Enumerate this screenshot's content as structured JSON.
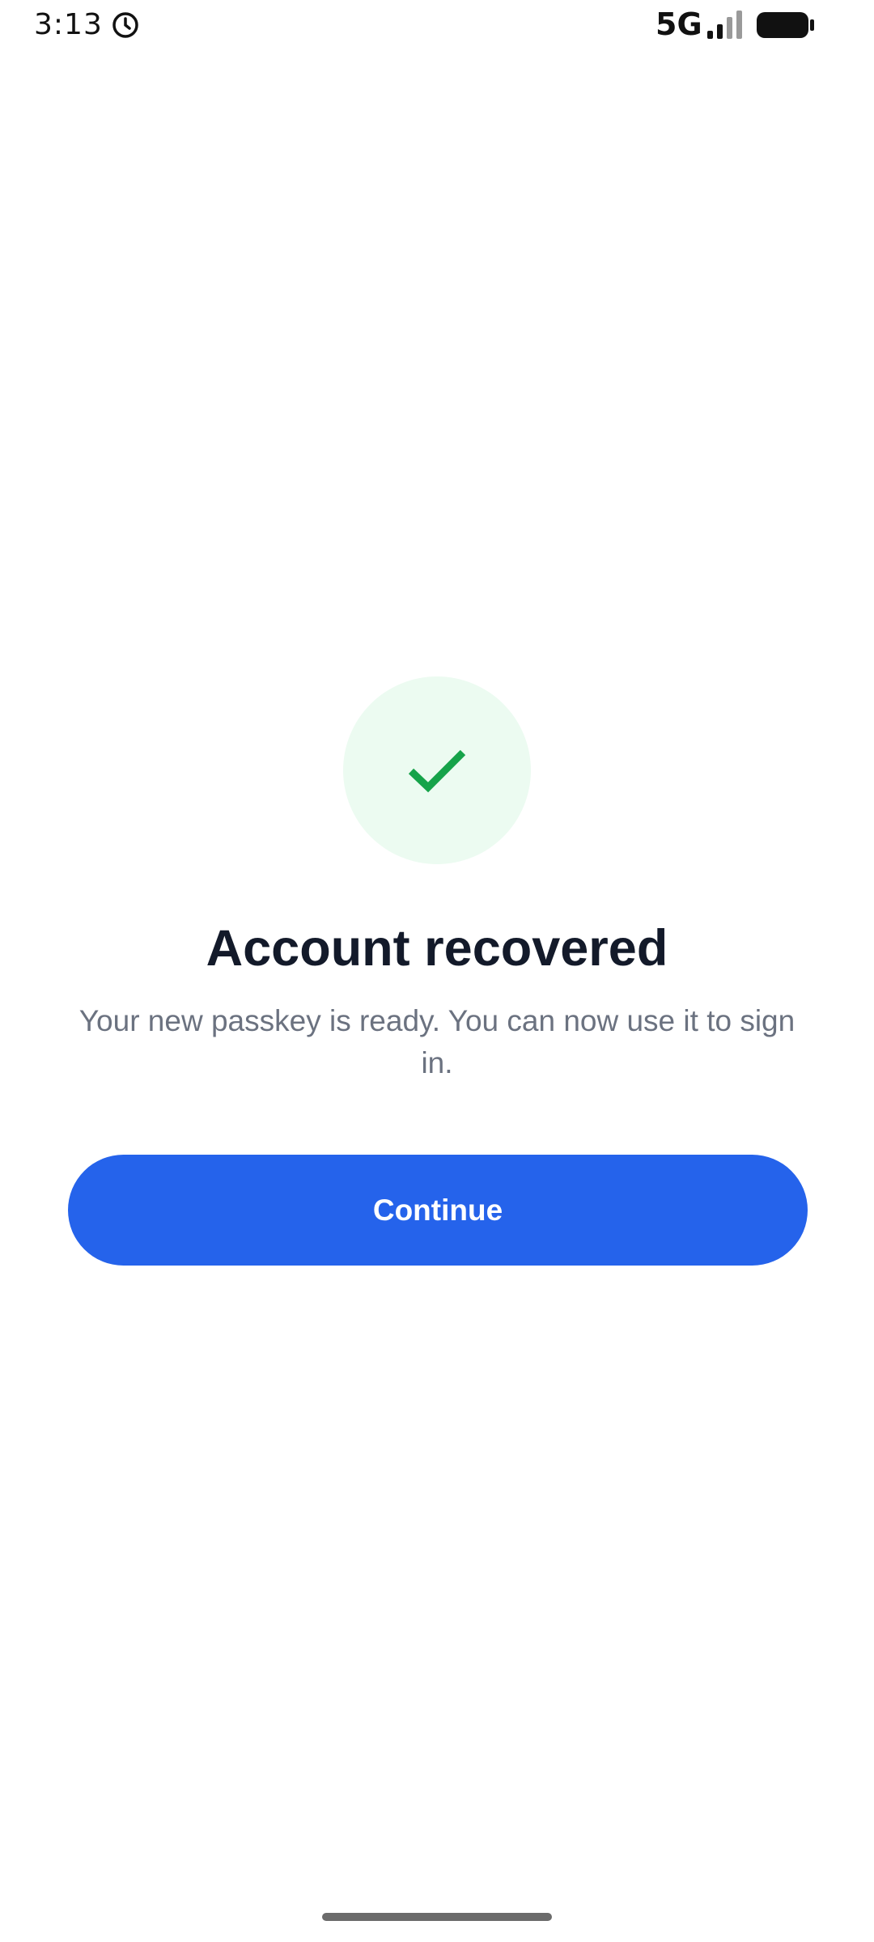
{
  "status_bar": {
    "time": "3:13",
    "network": "5G",
    "icons": [
      "alarm-icon",
      "signal-icon",
      "battery-icon"
    ]
  },
  "success": {
    "icon": "checkmark-icon",
    "badge_color": "#ecfbf1",
    "check_color": "#16a34a"
  },
  "content": {
    "title": "Account recovered",
    "message": "Your new passkey is ready. You can now use it to sign in."
  },
  "actions": {
    "continue_label": "Continue",
    "accent_color": "#2563eb"
  }
}
